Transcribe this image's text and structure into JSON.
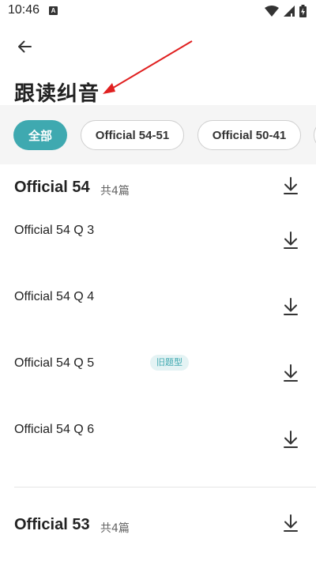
{
  "status_bar": {
    "time": "10:46",
    "app_icon_letter": "A",
    "icons": [
      "wifi-icon",
      "signal-icon",
      "battery-icon"
    ]
  },
  "header": {
    "back_icon": "arrow-left-icon",
    "title": "跟读纠音"
  },
  "filters": {
    "chips": [
      "全部",
      "Official 54-51",
      "Official 50-41"
    ],
    "active_index": 0,
    "accent_color": "#3fa9b0"
  },
  "groups": [
    {
      "title": "Official 54",
      "count": "共4篇",
      "items": [
        {
          "title": "Official 54 Q 3",
          "badge": ""
        },
        {
          "title": "Official 54 Q 4",
          "badge": ""
        },
        {
          "title": "Official 54 Q 5",
          "badge": "旧题型"
        },
        {
          "title": "Official 54 Q 6",
          "badge": ""
        }
      ]
    },
    {
      "title": "Official 53",
      "count": "共4篇",
      "items": []
    }
  ],
  "annotation": {
    "arrow_color": "#e02020"
  }
}
